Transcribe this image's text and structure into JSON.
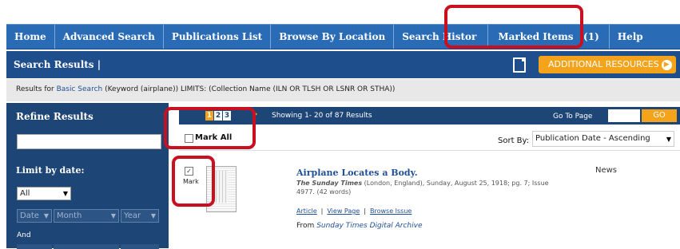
{
  "nav": {
    "items": [
      {
        "label": "Home",
        "name": "nav-home"
      },
      {
        "label": "Advanced Search",
        "name": "nav-advanced-search"
      },
      {
        "label": "Publications List",
        "name": "nav-publications-list"
      },
      {
        "label": "Browse By Location",
        "name": "nav-browse-by-location"
      },
      {
        "label": "Search Histor",
        "name": "nav-search-history"
      },
      {
        "label": "Marked Items   (1)",
        "name": "nav-marked-items"
      },
      {
        "label": "Help",
        "name": "nav-help"
      }
    ]
  },
  "search_results_bar": {
    "title": "Search Results |",
    "doc_icon": "document-icon",
    "additional_resources": "ADDITIONAL RESOURCES",
    "arrow_icon": "arrow-right-circle-icon"
  },
  "results_for": {
    "prefix": "Results for ",
    "link": "Basic Search",
    "suffix": " (Keyword (airplane)) LIMITS: (Collection Name (ILN OR TLSH OR LSNR OR STHA))"
  },
  "sidebar": {
    "refine_title": "Refine Results",
    "limit_by_date": "Limit by date:",
    "range_select": "All",
    "date_select": "Date",
    "month_select": "Month",
    "year_select": "Year",
    "and_label": "And"
  },
  "pagination": {
    "pages": [
      "1",
      "2",
      "3"
    ],
    "showing": "Showing 1- 20 of 87 Results",
    "go_to_page": "Go To Page",
    "go_button": "GO"
  },
  "toolbar": {
    "mark_all": "Mark All",
    "sort_by": "Sort By:",
    "sort_value": "Publication Date - Ascending"
  },
  "result": {
    "checked": true,
    "mark_label": "Mark",
    "title": "Airplane Locates a Body.",
    "source": "The Sunday Times",
    "meta": "(London, England), Sunday, August 25, 1918; pg. 7; Issue 4977.  (42 words)",
    "type": "News",
    "link_article": "Article",
    "link_view_page": "View Page",
    "link_browse_issue": "Browse Issue",
    "from_prefix": "From",
    "archive": "Sunday Times Digital Archive"
  },
  "colors": {
    "nav_blue": "#2a6bb5",
    "dark_blue": "#1d4575",
    "accent_orange": "#f5a31a",
    "highlight_red": "#c8101f"
  }
}
